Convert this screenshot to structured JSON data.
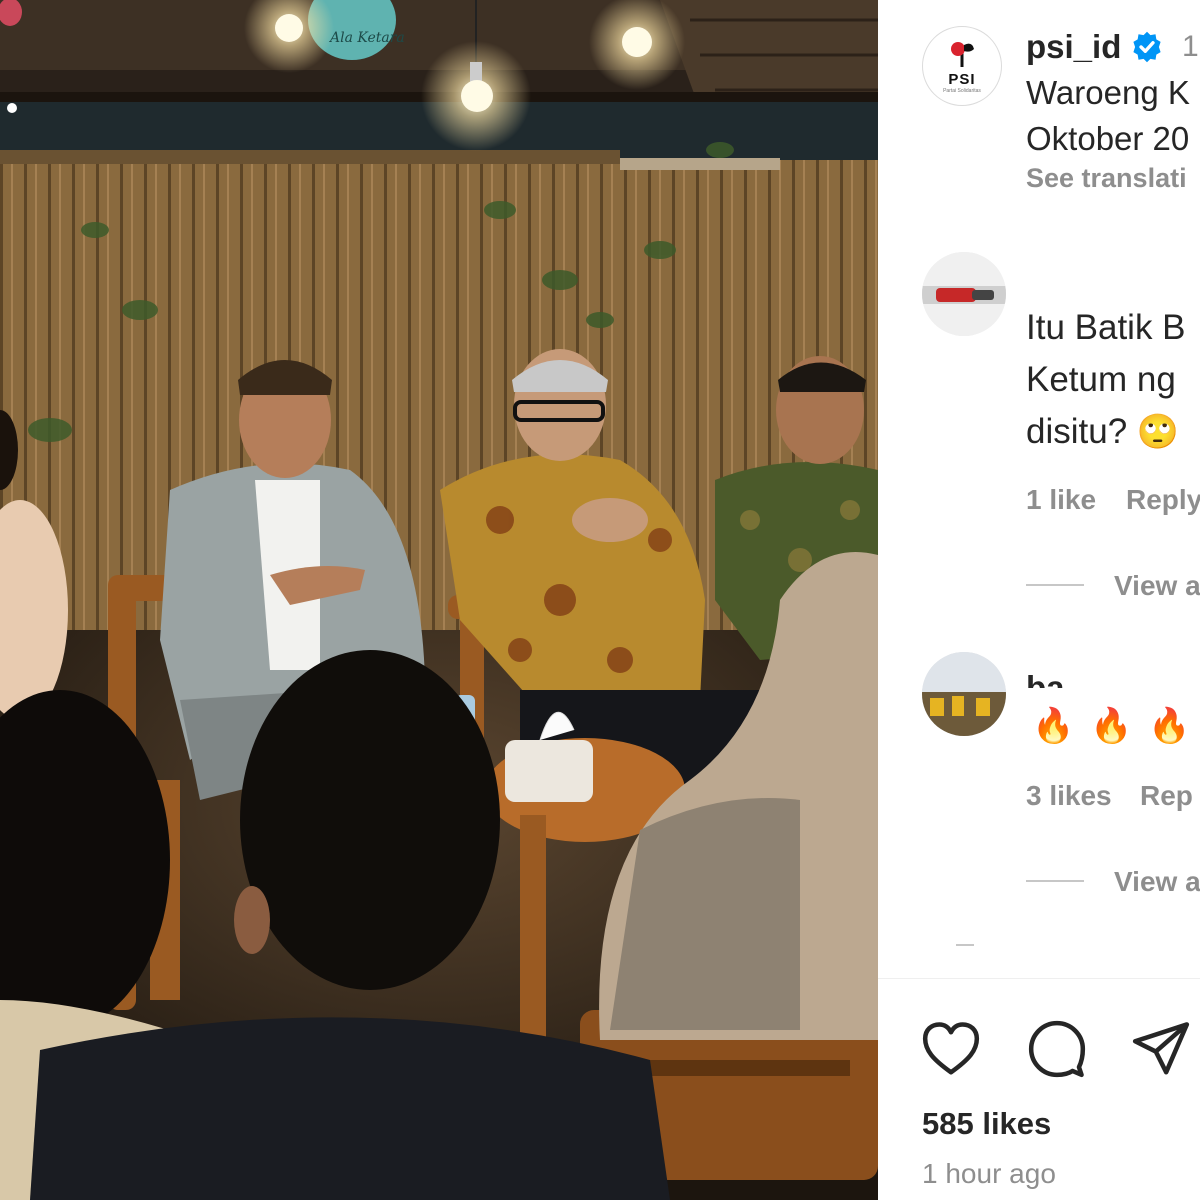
{
  "post": {
    "username": "psi_id",
    "time_fragment": "1",
    "caption_lines": [
      "Waroeng K",
      "Oktober 20"
    ],
    "see_translation": "See translati",
    "likes": "585 likes",
    "time_ago": "1 hour ago",
    "sign_lettering": "Ala Ketara"
  },
  "comments": [
    {
      "username_clipped": "... .. ..",
      "text_lines": [
        "Itu Batik B",
        "Ketum ng",
        "disitu?"
      ],
      "emoji": "🙄",
      "likes": "1 like",
      "reply": "Reply",
      "view_replies": "View a"
    },
    {
      "username_clipped": "ba.",
      "emojis": [
        "🔥",
        "🔥",
        "🔥"
      ],
      "likes": "3 likes",
      "reply": "Rep",
      "view_replies": "View a"
    }
  ],
  "colors": {
    "verified": "#0095f6",
    "secondary_text": "#8e8e8e",
    "primary_text": "#262626",
    "psi_red": "#d9232e"
  },
  "icons": [
    "heart-icon",
    "comment-icon",
    "share-icon",
    "verified-badge-icon"
  ]
}
